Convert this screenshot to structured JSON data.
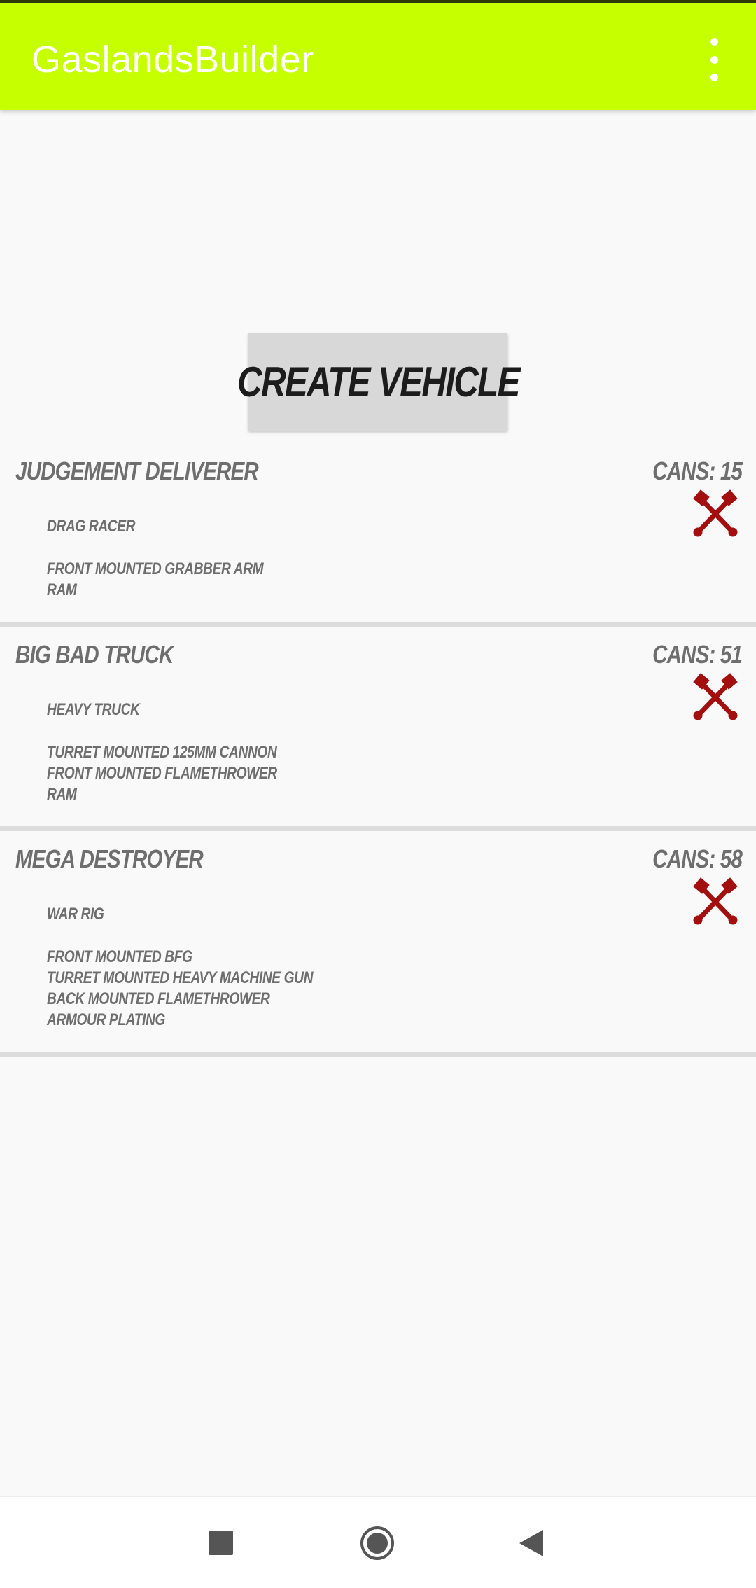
{
  "app": {
    "title": "GaslandsBuilder",
    "menu_icon": "more-vert-icon",
    "accent_color": "#c6ff00"
  },
  "create_button": {
    "label": "CREATE VEHICLE"
  },
  "vehicles": [
    {
      "name": "JUDGEMENT DELIVERER",
      "cans": "CANS: 15",
      "type": "DRAG RACER",
      "items": [
        "FRONT MOUNTED GRABBER ARM",
        "RAM"
      ],
      "delete_icon": "crossed-axes-icon"
    },
    {
      "name": "BIG BAD TRUCK",
      "cans": "CANS: 51",
      "type": "HEAVY TRUCK",
      "items": [
        "TURRET MOUNTED 125MM CANNON",
        "FRONT MOUNTED FLAMETHROWER",
        "RAM"
      ],
      "delete_icon": "crossed-axes-icon"
    },
    {
      "name": "MEGA DESTROYER",
      "cans": "CANS: 58",
      "type": "WAR RIG",
      "items": [
        "FRONT MOUNTED BFG",
        "TURRET MOUNTED HEAVY MACHINE GUN",
        "BACK MOUNTED FLAMETHROWER",
        "ARMOUR PLATING"
      ],
      "delete_icon": "crossed-axes-icon"
    }
  ],
  "navigation": {
    "recents_icon": "square-icon",
    "home_icon": "circle-icon",
    "back_icon": "triangle-back-icon"
  }
}
